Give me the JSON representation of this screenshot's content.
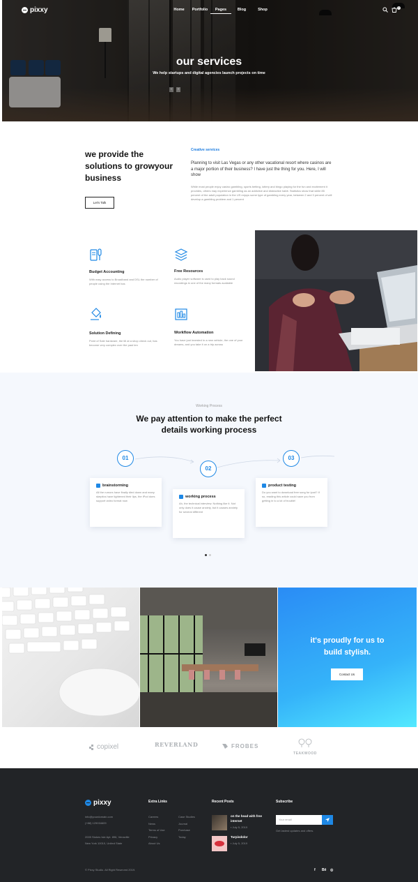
{
  "header": {
    "logo_text": "pixxy",
    "nav": [
      "Home",
      "Portfolio",
      "Pages",
      "Blog",
      "Shop"
    ],
    "active_nav": "Pages",
    "cart_count": "0"
  },
  "hero": {
    "title": "our services",
    "subtitle": "We help startups and digital agencies launch projects on time",
    "prev": "‹",
    "next": "›"
  },
  "provide": {
    "title_lines": [
      "we provide the",
      "solutions to growyour",
      "business"
    ],
    "button": "Let's Talk",
    "label": "Creative services",
    "lead": "Planning to visit Las Vegas or any other vacational resort where casinos are a major portion of their business? I have just the thing for you. Here, I will show",
    "body": "While most people enjoy casino gambling, sports betting, lottery and bingo playing for the fun and excitement it provides, others may experience gambling as an addictive and distractive habit. Statistics show that while 85 percent of the adult population in the US enjoys some type of gambling every year, between 2 and 3 percent of will develop a gambling problem and 1 percent"
  },
  "features": [
    {
      "title": "Budget Accounting",
      "desc": "With easy access to Broadband and DSL the number of people using the Internet has",
      "icon": "accounting-icon"
    },
    {
      "title": "Free Resources",
      "desc": "Audio player software is used to play back sound recordings in one of the many formats available",
      "icon": "layers-icon"
    },
    {
      "title": "Solution Defining",
      "desc": "Point of Sale hardware, the till at a shop check out, has become very complex over the past ten",
      "icon": "paint-bucket-icon"
    },
    {
      "title": "Workflow Automation",
      "desc": "You have just invested in a new vehicle, the one of your dreams, and you take it on a trip across",
      "icon": "workflow-icon"
    }
  ],
  "process": {
    "label": "Working Process",
    "title_lines": [
      "We pay attention to make the perfect",
      "details working process"
    ],
    "steps": [
      {
        "num": "01",
        "title": "brainstorming",
        "desc": "All the rumors have finally died down and many skeptics have tightened their lips, the iPod does support video format now",
        "icon": "brainstorm-icon"
      },
      {
        "num": "02",
        "title": "working process",
        "desc": "Ah, the technical interview. Nothing like it. Not only does it cause anxiety, but it causes anxiety for several different",
        "icon": "cube-icon"
      },
      {
        "num": "03",
        "title": "product testing",
        "desc": "Do you want to download free song for ipod? If so, reading this article could save you from getting in to a lot of trouble!",
        "icon": "test-icon"
      }
    ]
  },
  "cta": {
    "title_lines": [
      "it's proudly for us to",
      "build stylish."
    ],
    "button": "Contact Us"
  },
  "brands": [
    "copixel",
    "REVERLAND",
    "FROBES",
    "TEAKWOOD"
  ],
  "footer": {
    "logo_text": "pixxy",
    "email": "info@yourdomain.com",
    "phone": "(+88) 129034609",
    "address_lines": [
      "2005 Stokes Isle Apt. 896, Venaville",
      "New York 10010, United State"
    ],
    "extra_links_title": "Extra Links",
    "links_col1": [
      "Careers",
      "News",
      "Terms of Use",
      "Privacy",
      "About Us"
    ],
    "links_col2": [
      "Case Studies",
      "Journal",
      "Purchase",
      "Today"
    ],
    "recent_title": "Recent Posts",
    "posts": [
      {
        "title_lines": [
          "on the head with free",
          "internet"
        ],
        "date": "July 5, 2019"
      },
      {
        "title_lines": [
          "Turpisdolor"
        ],
        "date": "July 5, 2019"
      }
    ],
    "subscribe_title": "Subscribe",
    "email_placeholder": "Your email",
    "subscribe_note": "Get lastest updates and offers.",
    "copyright": "© Pixxy Studio. All Right Reserved 2019.",
    "social": [
      "f",
      "Bē",
      "◎"
    ]
  },
  "colors": {
    "accent": "#1e88e5",
    "footer_bg": "#222427",
    "process_bg": "#f5f8fd"
  }
}
